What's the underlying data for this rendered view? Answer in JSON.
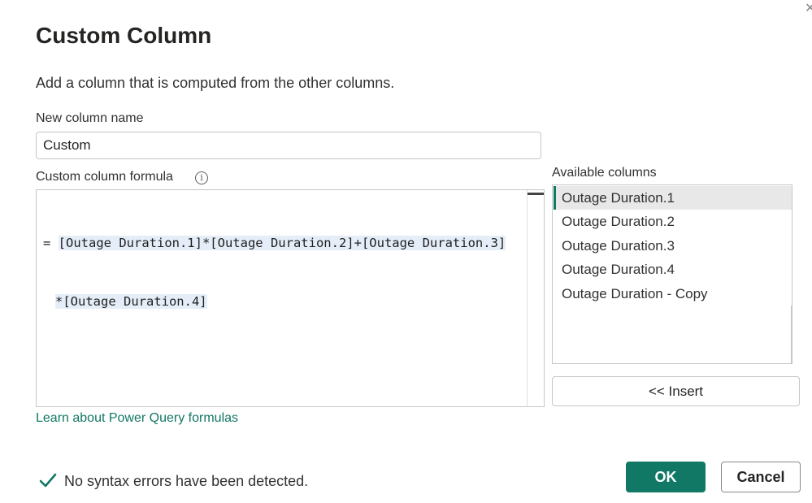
{
  "dialog": {
    "title": "Custom Column",
    "subtitle": "Add a column that is computed from the other columns.",
    "close_icon": "close-icon"
  },
  "name_field": {
    "label": "New column name",
    "value": "Custom"
  },
  "formula": {
    "label": "Custom column formula",
    "info_icon": "info-icon",
    "prefix": "= ",
    "line1": "[Outage Duration.1]*[Outage Duration.2]+[Outage Duration.3]",
    "line2": "*[Outage Duration.4]"
  },
  "available": {
    "label": "Available columns",
    "items": [
      "Outage Duration.1",
      "Outage Duration.2",
      "Outage Duration.3",
      "Outage Duration.4",
      "Outage Duration - Copy"
    ],
    "selected": "Outage Duration.1",
    "insert_label": "<< Insert"
  },
  "learn_link": "Learn about Power Query formulas",
  "status": {
    "icon": "check-icon",
    "text": "No syntax errors have been detected.",
    "color": "#117865"
  },
  "buttons": {
    "ok_label": "OK",
    "cancel_label": "Cancel",
    "accent": "#117865"
  }
}
